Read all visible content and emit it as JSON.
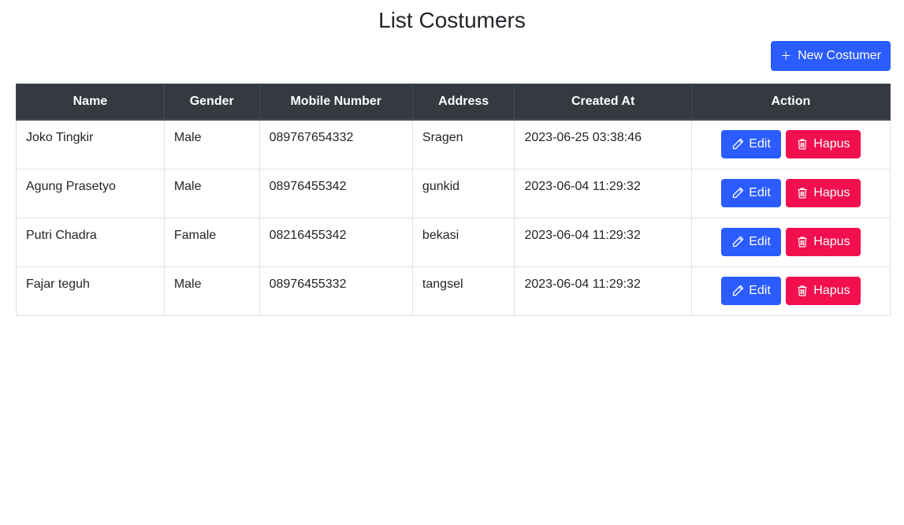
{
  "page": {
    "title": "List Costumers"
  },
  "toolbar": {
    "new_button_icon": "plus-icon",
    "new_button_label": "New Costumer"
  },
  "table": {
    "headers": {
      "name": "Name",
      "gender": "Gender",
      "mobile": "Mobile Number",
      "address": "Address",
      "created_at": "Created At",
      "action": "Action"
    },
    "rows": [
      {
        "name": "Joko Tingkir",
        "gender": "Male",
        "mobile": "089767654332",
        "address": "Sragen",
        "created_at": "2023-06-25 03:38:46"
      },
      {
        "name": "Agung Prasetyo",
        "gender": "Male",
        "mobile": "08976455342",
        "address": "gunkid",
        "created_at": "2023-06-04 11:29:32"
      },
      {
        "name": "Putri Chadra",
        "gender": "Famale",
        "mobile": "08216455342",
        "address": "bekasi",
        "created_at": "2023-06-04 11:29:32"
      },
      {
        "name": "Fajar teguh",
        "gender": "Male",
        "mobile": "08976455332",
        "address": "tangsel",
        "created_at": "2023-06-04 11:29:32"
      }
    ],
    "actions": {
      "edit_label": "Edit",
      "edit_icon": "pencil-icon",
      "delete_label": "Hapus",
      "delete_icon": "trash-icon"
    }
  },
  "colors": {
    "primary": "#2b5cff",
    "danger": "#f20f4e",
    "header_bg": "#343a40"
  }
}
